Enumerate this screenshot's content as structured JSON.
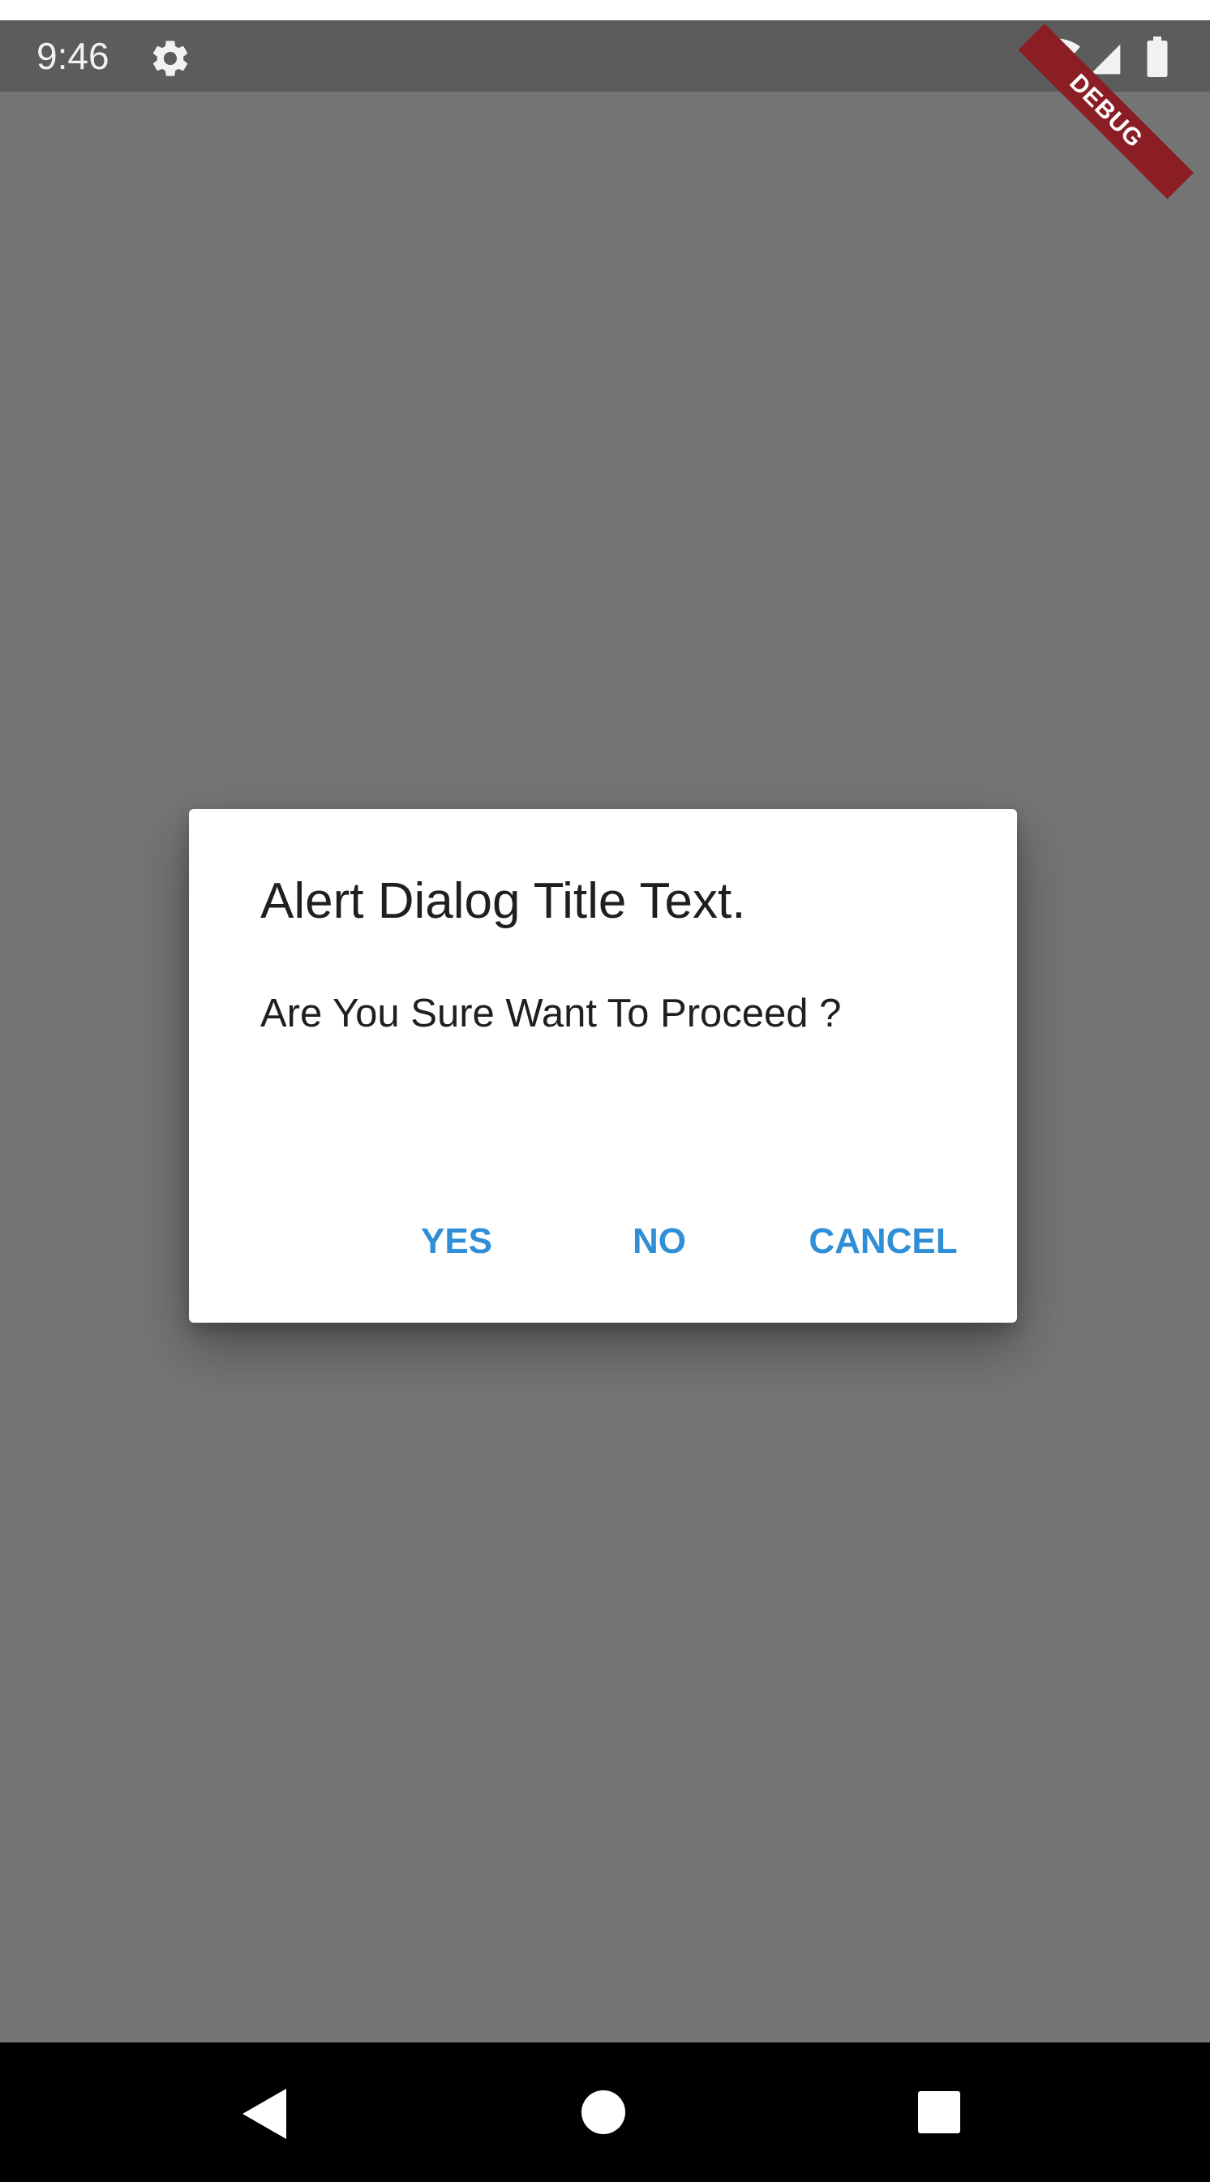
{
  "status_bar": {
    "time": "9:46",
    "icons": [
      "settings-icon",
      "wifi-icon",
      "signal-icon",
      "battery-icon"
    ],
    "debug_label": "DEBUG"
  },
  "dialog": {
    "title": "Alert Dialog Title Text.",
    "message": "Are You Sure Want To Proceed ?",
    "buttons": {
      "yes": "YES",
      "no": "NO",
      "cancel": "CANCEL"
    }
  },
  "navigation_bar": {
    "icons": [
      "back-icon",
      "home-icon",
      "recents-icon"
    ]
  },
  "colors": {
    "scrim": "#757575",
    "status_bar": "#5c5c5c",
    "dialog_background": "#ffffff",
    "button_text": "#2f8ed8",
    "debug_banner": "#8b1e24",
    "nav_bar": "#000000"
  }
}
